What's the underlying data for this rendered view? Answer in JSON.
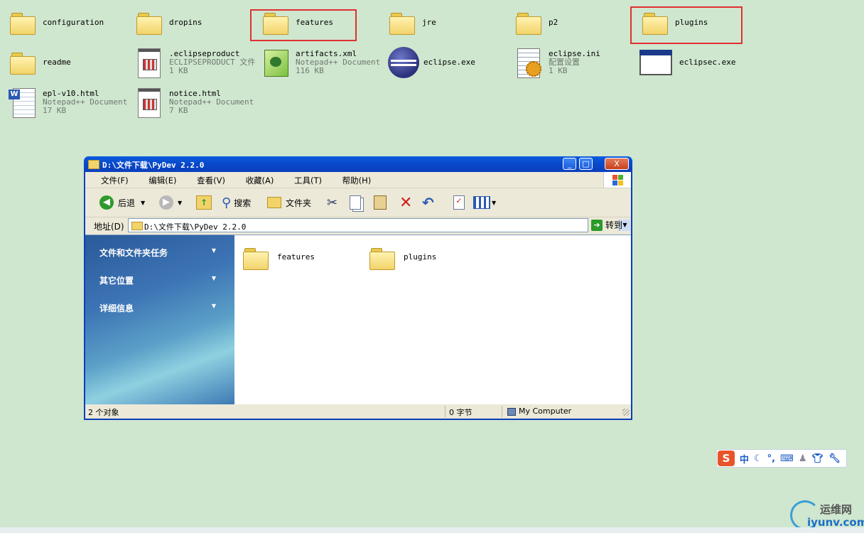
{
  "desktop": {
    "items": [
      {
        "name": "configuration",
        "type": "folder"
      },
      {
        "name": "dropins",
        "type": "folder"
      },
      {
        "name": "features",
        "type": "folder"
      },
      {
        "name": "jre",
        "type": "folder"
      },
      {
        "name": "p2",
        "type": "folder"
      },
      {
        "name": "plugins",
        "type": "folder"
      },
      {
        "name": "readme",
        "type": "folder"
      },
      {
        "name": ".eclipseproduct",
        "type_label": "ECLIPSEPRODUCT 文件",
        "size": "1 KB"
      },
      {
        "name": "artifacts.xml",
        "type_label": "Notepad++ Document",
        "size": "116 KB"
      },
      {
        "name": "eclipse.exe"
      },
      {
        "name": "eclipse.ini",
        "type_label": "配置设置",
        "size": "1 KB"
      },
      {
        "name": "eclipsec.exe"
      },
      {
        "name": "epl-v10.html",
        "type_label": "Notepad++ Document",
        "size": "17 KB"
      },
      {
        "name": "notice.html",
        "type_label": "Notepad++ Document",
        "size": "7 KB"
      }
    ]
  },
  "window": {
    "title": "D:\\文件下载\\PyDev 2.2.0",
    "controls": {
      "minimize": "_",
      "maximize": "□",
      "close": "X"
    },
    "menu": [
      "文件(F)",
      "编辑(E)",
      "查看(V)",
      "收藏(A)",
      "工具(T)",
      "帮助(H)"
    ],
    "toolbar": {
      "back": "后退",
      "search": "搜索",
      "folders": "文件夹"
    },
    "address": {
      "label": "地址(D)",
      "value": "D:\\文件下载\\PyDev 2.2.0",
      "go": "转到"
    },
    "sidebar": [
      "文件和文件夹任务",
      "其它位置",
      "详细信息"
    ],
    "files": [
      "features",
      "plugins"
    ],
    "status": {
      "count": "2 个对象",
      "size": "0 字节",
      "location": "My Computer"
    }
  },
  "ime": {
    "logo": "S",
    "mode": "中"
  },
  "watermark": {
    "cn": "运维网",
    "en": "iyunv.com"
  }
}
